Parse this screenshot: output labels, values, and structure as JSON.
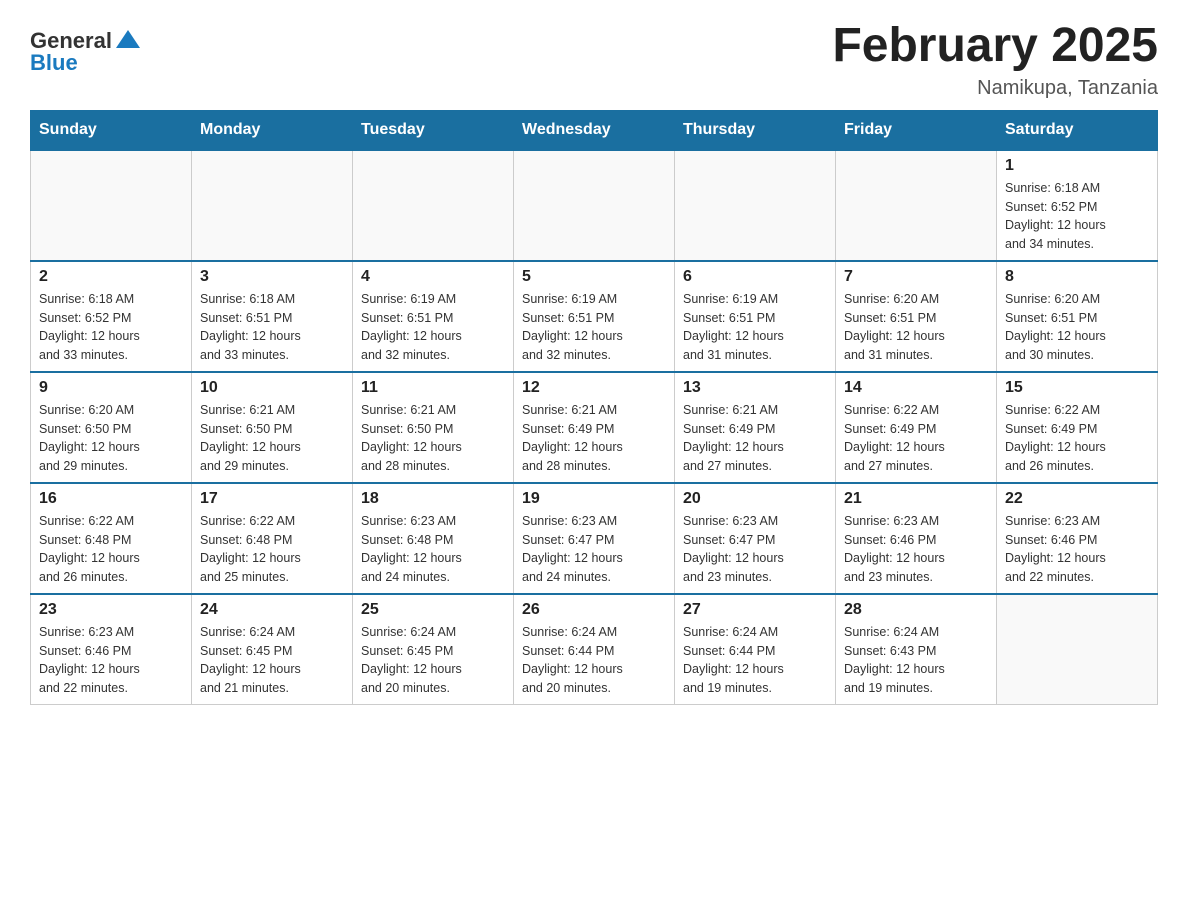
{
  "header": {
    "logo_general": "General",
    "logo_blue": "Blue",
    "month_title": "February 2025",
    "location": "Namikupa, Tanzania"
  },
  "weekdays": [
    "Sunday",
    "Monday",
    "Tuesday",
    "Wednesday",
    "Thursday",
    "Friday",
    "Saturday"
  ],
  "weeks": [
    [
      {
        "day": "",
        "info": ""
      },
      {
        "day": "",
        "info": ""
      },
      {
        "day": "",
        "info": ""
      },
      {
        "day": "",
        "info": ""
      },
      {
        "day": "",
        "info": ""
      },
      {
        "day": "",
        "info": ""
      },
      {
        "day": "1",
        "info": "Sunrise: 6:18 AM\nSunset: 6:52 PM\nDaylight: 12 hours\nand 34 minutes."
      }
    ],
    [
      {
        "day": "2",
        "info": "Sunrise: 6:18 AM\nSunset: 6:52 PM\nDaylight: 12 hours\nand 33 minutes."
      },
      {
        "day": "3",
        "info": "Sunrise: 6:18 AM\nSunset: 6:51 PM\nDaylight: 12 hours\nand 33 minutes."
      },
      {
        "day": "4",
        "info": "Sunrise: 6:19 AM\nSunset: 6:51 PM\nDaylight: 12 hours\nand 32 minutes."
      },
      {
        "day": "5",
        "info": "Sunrise: 6:19 AM\nSunset: 6:51 PM\nDaylight: 12 hours\nand 32 minutes."
      },
      {
        "day": "6",
        "info": "Sunrise: 6:19 AM\nSunset: 6:51 PM\nDaylight: 12 hours\nand 31 minutes."
      },
      {
        "day": "7",
        "info": "Sunrise: 6:20 AM\nSunset: 6:51 PM\nDaylight: 12 hours\nand 31 minutes."
      },
      {
        "day": "8",
        "info": "Sunrise: 6:20 AM\nSunset: 6:51 PM\nDaylight: 12 hours\nand 30 minutes."
      }
    ],
    [
      {
        "day": "9",
        "info": "Sunrise: 6:20 AM\nSunset: 6:50 PM\nDaylight: 12 hours\nand 29 minutes."
      },
      {
        "day": "10",
        "info": "Sunrise: 6:21 AM\nSunset: 6:50 PM\nDaylight: 12 hours\nand 29 minutes."
      },
      {
        "day": "11",
        "info": "Sunrise: 6:21 AM\nSunset: 6:50 PM\nDaylight: 12 hours\nand 28 minutes."
      },
      {
        "day": "12",
        "info": "Sunrise: 6:21 AM\nSunset: 6:49 PM\nDaylight: 12 hours\nand 28 minutes."
      },
      {
        "day": "13",
        "info": "Sunrise: 6:21 AM\nSunset: 6:49 PM\nDaylight: 12 hours\nand 27 minutes."
      },
      {
        "day": "14",
        "info": "Sunrise: 6:22 AM\nSunset: 6:49 PM\nDaylight: 12 hours\nand 27 minutes."
      },
      {
        "day": "15",
        "info": "Sunrise: 6:22 AM\nSunset: 6:49 PM\nDaylight: 12 hours\nand 26 minutes."
      }
    ],
    [
      {
        "day": "16",
        "info": "Sunrise: 6:22 AM\nSunset: 6:48 PM\nDaylight: 12 hours\nand 26 minutes."
      },
      {
        "day": "17",
        "info": "Sunrise: 6:22 AM\nSunset: 6:48 PM\nDaylight: 12 hours\nand 25 minutes."
      },
      {
        "day": "18",
        "info": "Sunrise: 6:23 AM\nSunset: 6:48 PM\nDaylight: 12 hours\nand 24 minutes."
      },
      {
        "day": "19",
        "info": "Sunrise: 6:23 AM\nSunset: 6:47 PM\nDaylight: 12 hours\nand 24 minutes."
      },
      {
        "day": "20",
        "info": "Sunrise: 6:23 AM\nSunset: 6:47 PM\nDaylight: 12 hours\nand 23 minutes."
      },
      {
        "day": "21",
        "info": "Sunrise: 6:23 AM\nSunset: 6:46 PM\nDaylight: 12 hours\nand 23 minutes."
      },
      {
        "day": "22",
        "info": "Sunrise: 6:23 AM\nSunset: 6:46 PM\nDaylight: 12 hours\nand 22 minutes."
      }
    ],
    [
      {
        "day": "23",
        "info": "Sunrise: 6:23 AM\nSunset: 6:46 PM\nDaylight: 12 hours\nand 22 minutes."
      },
      {
        "day": "24",
        "info": "Sunrise: 6:24 AM\nSunset: 6:45 PM\nDaylight: 12 hours\nand 21 minutes."
      },
      {
        "day": "25",
        "info": "Sunrise: 6:24 AM\nSunset: 6:45 PM\nDaylight: 12 hours\nand 20 minutes."
      },
      {
        "day": "26",
        "info": "Sunrise: 6:24 AM\nSunset: 6:44 PM\nDaylight: 12 hours\nand 20 minutes."
      },
      {
        "day": "27",
        "info": "Sunrise: 6:24 AM\nSunset: 6:44 PM\nDaylight: 12 hours\nand 19 minutes."
      },
      {
        "day": "28",
        "info": "Sunrise: 6:24 AM\nSunset: 6:43 PM\nDaylight: 12 hours\nand 19 minutes."
      },
      {
        "day": "",
        "info": ""
      }
    ]
  ]
}
